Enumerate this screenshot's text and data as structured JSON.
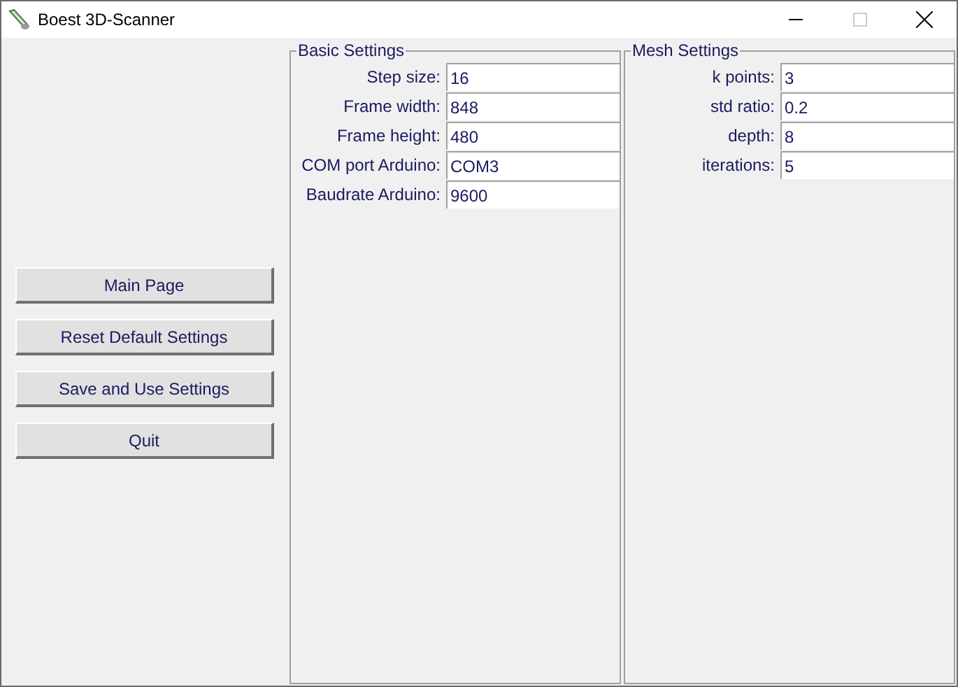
{
  "window": {
    "title": "Boest 3D-Scanner"
  },
  "buttons": [
    "Main Page",
    "Reset Default Settings",
    "Save and Use Settings",
    "Quit"
  ],
  "frames": [
    {
      "title": "Basic Settings",
      "fields": [
        {
          "label": "Step size:",
          "value": "16"
        },
        {
          "label": "Frame width:",
          "value": "848"
        },
        {
          "label": "Frame height:",
          "value": "480"
        },
        {
          "label": "COM port Arduino:",
          "value": "COM3"
        },
        {
          "label": "Baudrate Arduino:",
          "value": "9600"
        }
      ]
    },
    {
      "title": "Mesh Settings",
      "fields": [
        {
          "label": "k points:",
          "value": "3"
        },
        {
          "label": "std ratio:",
          "value": "0.2"
        },
        {
          "label": "depth:",
          "value": "8"
        },
        {
          "label": "iterations:",
          "value": "5"
        }
      ]
    }
  ]
}
